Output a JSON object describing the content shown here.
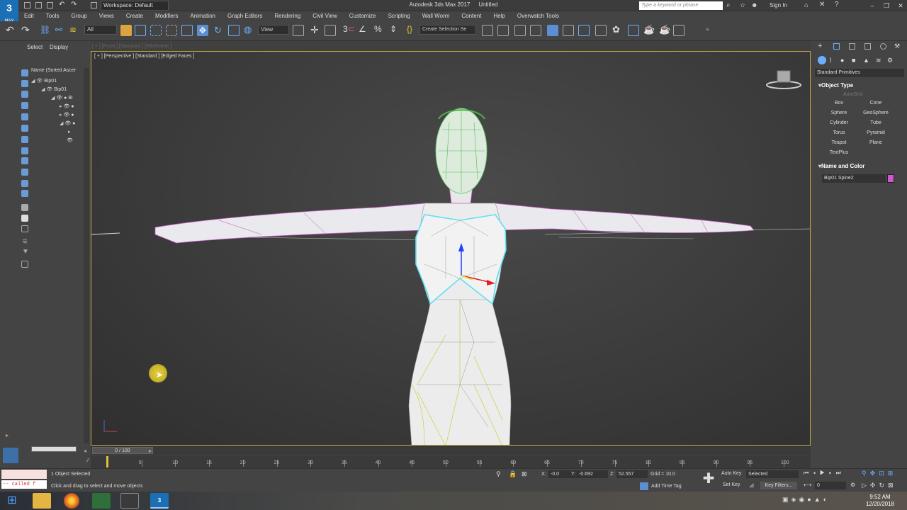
{
  "title_bar": {
    "app_name": "Autodesk 3ds Max 2017",
    "document": "Untitled",
    "workspace": "Workspace: Default",
    "search_placeholder": "Type a keyword or phrase",
    "sign_in": "Sign In",
    "logo_text": "3",
    "logo_sub": "MAX"
  },
  "menu": [
    "Edit",
    "Tools",
    "Group",
    "Views",
    "Create",
    "Modifiers",
    "Animation",
    "Graph Editors",
    "Rendering",
    "Civil View",
    "Customize",
    "Scripting",
    "Wall Worm",
    "Content",
    "Help",
    "Overwatch Tools"
  ],
  "toolbar": {
    "selection_filter": "All",
    "ref_coord": "View",
    "named_selection": "Create Selection Se"
  },
  "explorer": {
    "tabs": [
      "Select",
      "Display"
    ],
    "header": "Name (Sorted Ascer",
    "rows": [
      "Bip01",
      "Bip01",
      "Bi"
    ]
  },
  "viewport": {
    "label": "[ + ] [Perspective ] [Standard ] [Edged Faces ]",
    "ghost_label": "[ + ] [Front ] [Standard ] [Wireframe ]"
  },
  "command_panel": {
    "category": "Standard Primitives",
    "object_type_title": "Object Type",
    "autogrid": "AutoGrid",
    "primitives": [
      "Box",
      "Cone",
      "Sphere",
      "GeoSphere",
      "Cylinder",
      "Tube",
      "Torus",
      "Pyramid",
      "Teapot",
      "Plane",
      "TextPlus"
    ],
    "name_color_title": "Name and Color",
    "object_name": "Bip01 Spine2",
    "object_color": "#d255d2"
  },
  "timeline": {
    "frame_display": "0 / 100",
    "ticks": [
      5,
      10,
      15,
      20,
      25,
      30,
      35,
      40,
      45,
      50,
      55,
      60,
      65,
      70,
      75,
      80,
      85,
      90,
      95,
      100
    ]
  },
  "status": {
    "maxscript_output": "-- called f",
    "selection": "1 Object Selected",
    "prompt": "Click and drag to select and move objects",
    "x_label": "X:",
    "x": "-0.0",
    "y_label": "Y:",
    "y": "-0.692",
    "z_label": "Z:",
    "z": "52.557",
    "grid": "Grid = 10.0",
    "add_time_tag": "Add Time Tag",
    "auto_key": "Auto Key",
    "set_key": "Set Key",
    "key_mode": "Selected",
    "key_filters": "Key Filters...",
    "current_frame": "0"
  },
  "taskbar": {
    "time": "9:52 AM",
    "date": "12/20/2018"
  },
  "colors": {
    "viewport_border": "#c9a53a",
    "accent_blue": "#1a6fb5",
    "highlight_cyan": "#5fe0f0"
  }
}
